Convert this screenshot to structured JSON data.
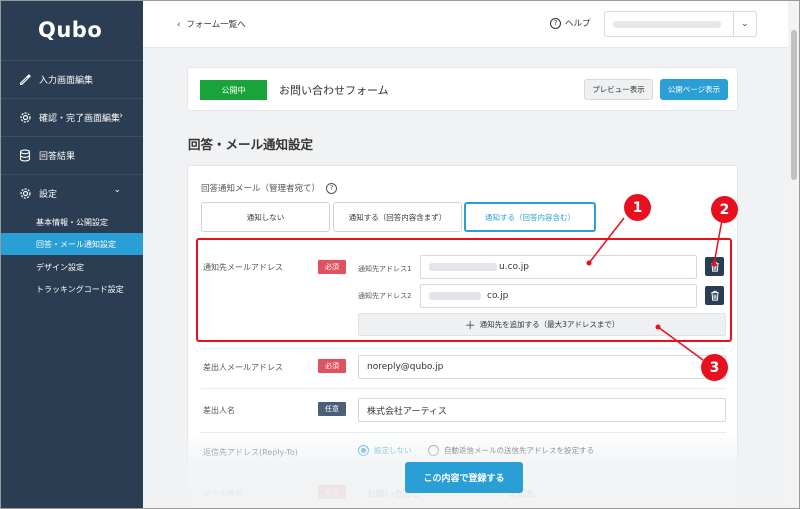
{
  "app": {
    "logo": "Qubo"
  },
  "sidebar": {
    "items": [
      {
        "label": "入力画面編集",
        "icon": "edit-icon"
      },
      {
        "label": "確認・完了画面編集",
        "icon": "gear-icon",
        "chevron": "›"
      },
      {
        "label": "回答結果",
        "icon": "database-icon"
      },
      {
        "label": "設定",
        "icon": "gear-icon",
        "chevron": "⌄"
      }
    ],
    "sub_items": [
      {
        "label": "基本情報・公開設定"
      },
      {
        "label": "回答・メール通知設定"
      },
      {
        "label": "デザイン設定"
      },
      {
        "label": "トラッキングコード設定"
      }
    ]
  },
  "header": {
    "back_label": "フォーム一覧へ",
    "help_label": "ヘルプ"
  },
  "form": {
    "status_badge": "公開中",
    "title": "お問い合わせフォーム",
    "preview_label": "プレビュー表示",
    "public_label": "公開ページ表示"
  },
  "section": {
    "title": "回答・メール通知設定"
  },
  "notify": {
    "label": "回答通知メール（管理者宛て）",
    "options": [
      "通知しない",
      "通知する（回答内容含まず）",
      "通知する（回答内容含む）"
    ],
    "selected_index": 2
  },
  "fields": {
    "notify_address": {
      "label": "通知先メールアドレス",
      "badge": "必須",
      "address1_label": "通知先アドレス1",
      "address1_suffix": "u.co.jp",
      "address2_label": "通知先アドレス2",
      "address2_suffix": "co.jp",
      "add_label": "通知先を追加する（最大3アドレスまで）"
    },
    "sender_address": {
      "label": "差出人メールアドレス",
      "badge": "必須",
      "value": "noreply@qubo.jp"
    },
    "sender_name": {
      "label": "差出人名",
      "badge": "任意",
      "value": "株式会社アーティス"
    },
    "reply_to": {
      "label": "返信先アドレス(Reply-To)",
      "options": [
        "設定しない",
        "自動返信メールの送信先アドレスを設定する"
      ],
      "selected_index": 0
    },
    "mail_subject": {
      "label": "メール件名",
      "badge": "必須",
      "value": "お問い合わせ",
      "value_tail": "ました"
    }
  },
  "submit_label": "この内容で登録する",
  "callouts": [
    "1",
    "2",
    "3"
  ],
  "colors": {
    "sidebar": "#2b3d52",
    "accent": "#2a9fd6",
    "published": "#19a43b",
    "required": "#e05260",
    "annotation": "#e8101e"
  }
}
